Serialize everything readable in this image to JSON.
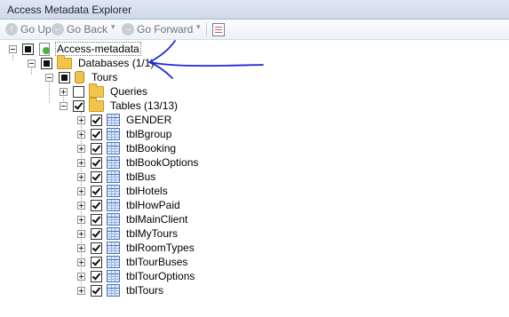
{
  "window": {
    "title": "Access Metadata Explorer"
  },
  "toolbar": {
    "go_up": "Go Up",
    "go_back": "Go Back",
    "go_forward": "Go Forward"
  },
  "tree": {
    "root": {
      "label": "Access-metadata"
    },
    "databases": {
      "label": "Databases (1/1)"
    },
    "tours": {
      "label": "Tours"
    },
    "queries": {
      "label": "Queries"
    },
    "tables": {
      "label": "Tables (13/13)"
    },
    "table_items": [
      "GENDER",
      "tblBgroup",
      "tblBooking",
      "tblBookOptions",
      "tblBus",
      "tblHotels",
      "tblHowPaid",
      "tblMainClient",
      "tblMyTours",
      "tblRoomTypes",
      "tblTourBuses",
      "tblTourOptions",
      "tblTours"
    ]
  },
  "annotation": {
    "stroke_color": "#1f2ad6"
  }
}
